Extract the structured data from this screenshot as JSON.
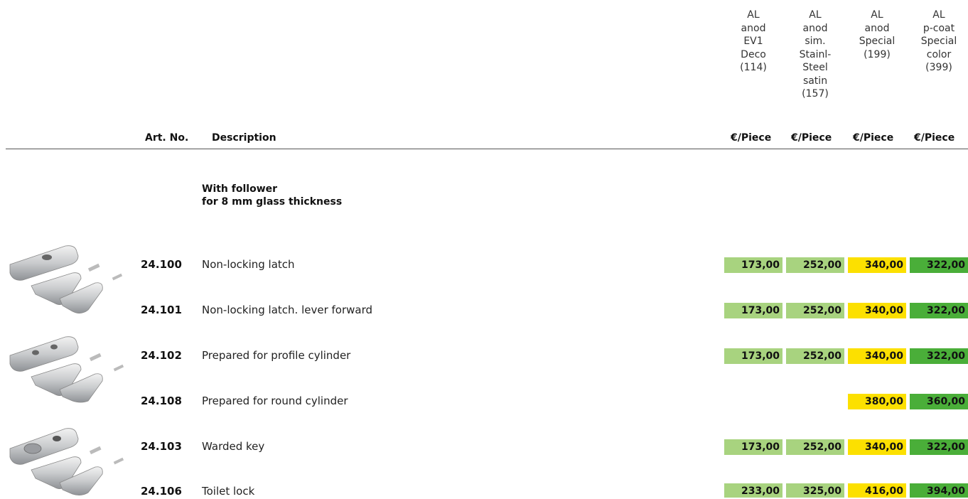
{
  "finish_columns": [
    {
      "label": "AL\nanod\nEV1\nDeco\n(114)",
      "price_header": "€/Piece"
    },
    {
      "label": "AL\nanod\nsim.\nStainl-\nSteel\nsatin\n(157)",
      "price_header": "€/Piece"
    },
    {
      "label": "AL\nanod\nSpecial\n(199)",
      "price_header": "€/Piece"
    },
    {
      "label": "AL\np-coat\nSpecial\ncolor\n(399)",
      "price_header": "€/Piece"
    }
  ],
  "table_header": {
    "art_no": "Art. No.",
    "description": "Description"
  },
  "section_title": "With follower\nfor 8 mm glass thickness",
  "colors": {
    "light_green": "#a8d37f",
    "yellow": "#fce000",
    "green": "#4aae39"
  },
  "rows": [
    {
      "art_no": "24.100",
      "description": "Non-locking latch",
      "prices": [
        "173,00",
        "252,00",
        "340,00",
        "322,00"
      ]
    },
    {
      "art_no": "24.101",
      "description": "Non-locking latch. lever forward",
      "prices": [
        "173,00",
        "252,00",
        "340,00",
        "322,00"
      ]
    },
    {
      "art_no": "24.102",
      "description": "Prepared for profile cylinder",
      "prices": [
        "173,00",
        "252,00",
        "340,00",
        "322,00"
      ]
    },
    {
      "art_no": "24.108",
      "description": "Prepared for round cylinder",
      "prices": [
        "",
        "",
        "380,00",
        "360,00"
      ]
    },
    {
      "art_no": "24.103",
      "description": "Warded key",
      "prices": [
        "173,00",
        "252,00",
        "340,00",
        "322,00"
      ]
    },
    {
      "art_no": "24.106",
      "description": "Toilet lock",
      "prices": [
        "233,00",
        "325,00",
        "416,00",
        "394,00"
      ]
    }
  ],
  "product_images": [
    {
      "name": "latch-set-image"
    },
    {
      "name": "profile-cylinder-set-image"
    },
    {
      "name": "warded-key-set-image"
    }
  ]
}
